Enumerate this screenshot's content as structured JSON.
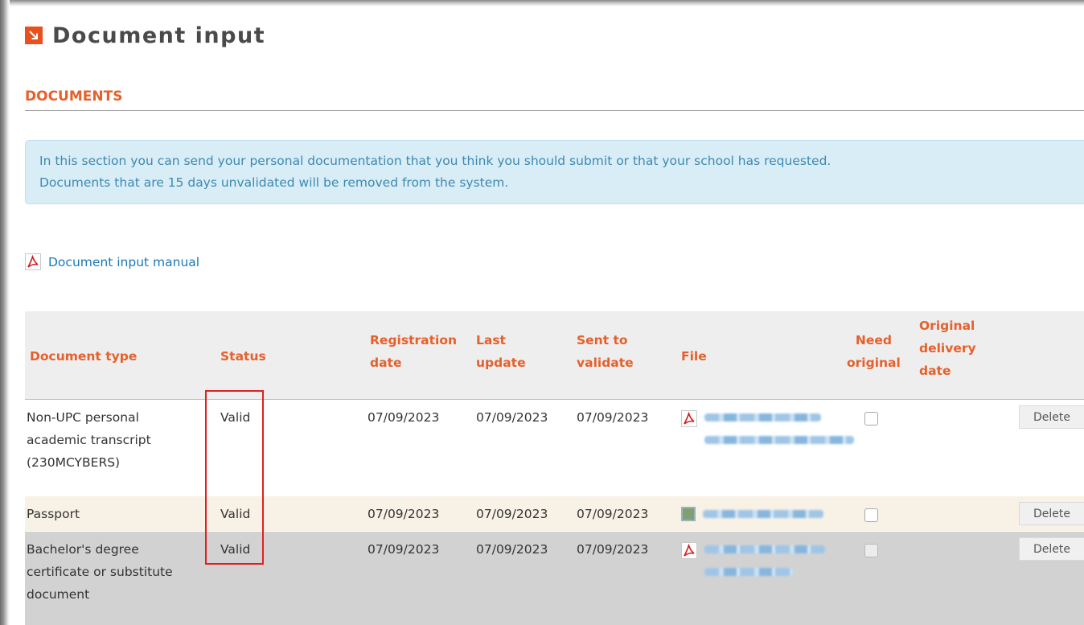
{
  "page": {
    "title": "Document input",
    "title_icon": "arrow-down-right-icon"
  },
  "section": {
    "title": "DOCUMENTS"
  },
  "info": {
    "line1": "In this section you can send your personal documentation that you think you should submit or that your school has requested.",
    "line2": "Documents that are 15 days unvalidated will be removed from the system."
  },
  "manual": {
    "label": "Document input manual",
    "icon": "pdf-icon"
  },
  "table": {
    "headers": {
      "doc_type": "Document type",
      "status": "Status",
      "reg_date_1": "Registration",
      "reg_date_2": "date",
      "last_update_1": "Last",
      "last_update_2": "update",
      "sent_1": "Sent to",
      "sent_2": "validate",
      "file": "File",
      "need_orig_1": "Need",
      "need_orig_2": "original",
      "orig_del_1": "Original",
      "orig_del_2": "delivery",
      "orig_del_3": "date"
    },
    "rows": [
      {
        "type_lines": [
          "Non-UPC personal",
          "academic transcript",
          "(230MCYBERS)"
        ],
        "status": "Valid",
        "registration_date": "07/09/2023",
        "last_update": "07/09/2023",
        "sent_to_validate": "07/09/2023",
        "file_icon": "pdf-icon",
        "need_original": false,
        "delete_label": "Delete"
      },
      {
        "type_lines": [
          "Passport"
        ],
        "status": "Valid",
        "registration_date": "07/09/2023",
        "last_update": "07/09/2023",
        "sent_to_validate": "07/09/2023",
        "file_icon": "image-file-icon",
        "need_original": false,
        "delete_label": "Delete"
      },
      {
        "type_lines": [
          "Bachelor's degree",
          "certificate or substitute",
          "document"
        ],
        "status": "Valid",
        "registration_date": "07/09/2023",
        "last_update": "07/09/2023",
        "sent_to_validate": "07/09/2023",
        "file_icon": "pdf-icon",
        "need_original": false,
        "delete_label": "Delete"
      }
    ]
  },
  "colors": {
    "accent_orange": "#e5602b",
    "title_icon_bg": "#e8501d",
    "info_bg": "#d9edf6",
    "info_text": "#3d89b2",
    "link_blue": "#1b78b8",
    "highlight_red": "#e02020"
  }
}
